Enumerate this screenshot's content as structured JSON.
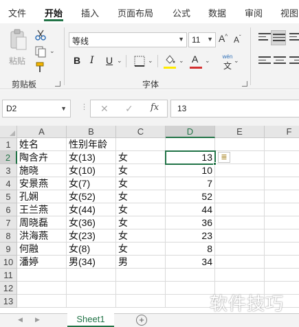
{
  "menu": {
    "tabs": [
      "文件",
      "开始",
      "插入",
      "页面布局",
      "公式",
      "数据",
      "审阅",
      "视图"
    ],
    "active": "开始"
  },
  "ribbon": {
    "clipboard": {
      "paste_label": "粘贴",
      "group_label": "剪贴板"
    },
    "font": {
      "font_name": "等线",
      "font_size": "11",
      "grow": "A",
      "shrink": "A",
      "bold": "B",
      "italic": "I",
      "underline": "U",
      "font_color_letter": "A",
      "phonetic": "wén",
      "group_label": "字体",
      "highlight_color": "#FFEB00",
      "font_color": "#D32F2F"
    }
  },
  "formula_bar": {
    "name_box": "D2",
    "cancel": "✕",
    "enter": "✓",
    "fx": "fx",
    "value": "13"
  },
  "grid": {
    "columns": [
      "A",
      "B",
      "C",
      "D",
      "E",
      "F"
    ],
    "selected_column": "D",
    "selected_row": "2",
    "rows": [
      {
        "num": "1",
        "a": "姓名",
        "b": "性别年龄",
        "c": "",
        "d": ""
      },
      {
        "num": "2",
        "a": "陶含卉",
        "b": "女(13)",
        "c": "女",
        "d": "13"
      },
      {
        "num": "3",
        "a": "施晓",
        "b": "女(10)",
        "c": "女",
        "d": "10"
      },
      {
        "num": "4",
        "a": "安景燕",
        "b": "女(7)",
        "c": "女",
        "d": "7"
      },
      {
        "num": "5",
        "a": "孔娴",
        "b": "女(52)",
        "c": "女",
        "d": "52"
      },
      {
        "num": "6",
        "a": "王兰燕",
        "b": "女(44)",
        "c": "女",
        "d": "44"
      },
      {
        "num": "7",
        "a": "周晓磊",
        "b": "女(36)",
        "c": "女",
        "d": "36"
      },
      {
        "num": "8",
        "a": "洪海燕",
        "b": "女(23)",
        "c": "女",
        "d": "23"
      },
      {
        "num": "9",
        "a": "何融",
        "b": "女(8)",
        "c": "女",
        "d": "8"
      },
      {
        "num": "10",
        "a": "潘婷",
        "b": "男(34)",
        "c": "男",
        "d": "34"
      },
      {
        "num": "11",
        "a": "",
        "b": "",
        "c": "",
        "d": ""
      },
      {
        "num": "12",
        "a": "",
        "b": "",
        "c": "",
        "d": ""
      },
      {
        "num": "13",
        "a": "",
        "b": "",
        "c": "",
        "d": ""
      }
    ]
  },
  "sheets": {
    "tabs": [
      "Sheet1"
    ],
    "add": "+"
  },
  "watermark": "软件技巧",
  "accent_color": "#217346"
}
